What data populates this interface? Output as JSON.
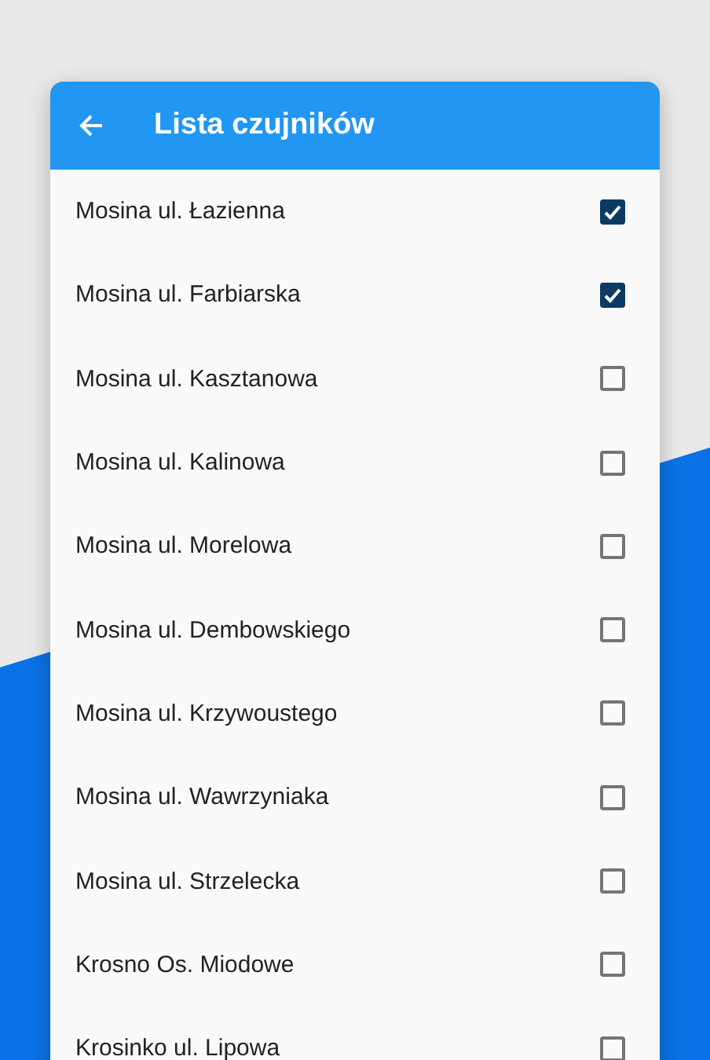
{
  "header": {
    "title": "Lista czujników"
  },
  "sensors": [
    {
      "name": "Mosina ul. Łazienna",
      "checked": true
    },
    {
      "name": "Mosina ul. Farbiarska",
      "checked": true
    },
    {
      "name": "Mosina ul. Kasztanowa",
      "checked": false
    },
    {
      "name": "Mosina ul. Kalinowa",
      "checked": false
    },
    {
      "name": "Mosina ul. Morelowa",
      "checked": false
    },
    {
      "name": "Mosina ul. Dembowskiego",
      "checked": false
    },
    {
      "name": "Mosina ul. Krzywoustego",
      "checked": false
    },
    {
      "name": "Mosina ul. Wawrzyniaka",
      "checked": false
    },
    {
      "name": "Mosina ul. Strzelecka",
      "checked": false
    },
    {
      "name": "Krosno Os. Miodowe",
      "checked": false
    },
    {
      "name": "Krosinko ul. Lipowa",
      "checked": false
    }
  ]
}
